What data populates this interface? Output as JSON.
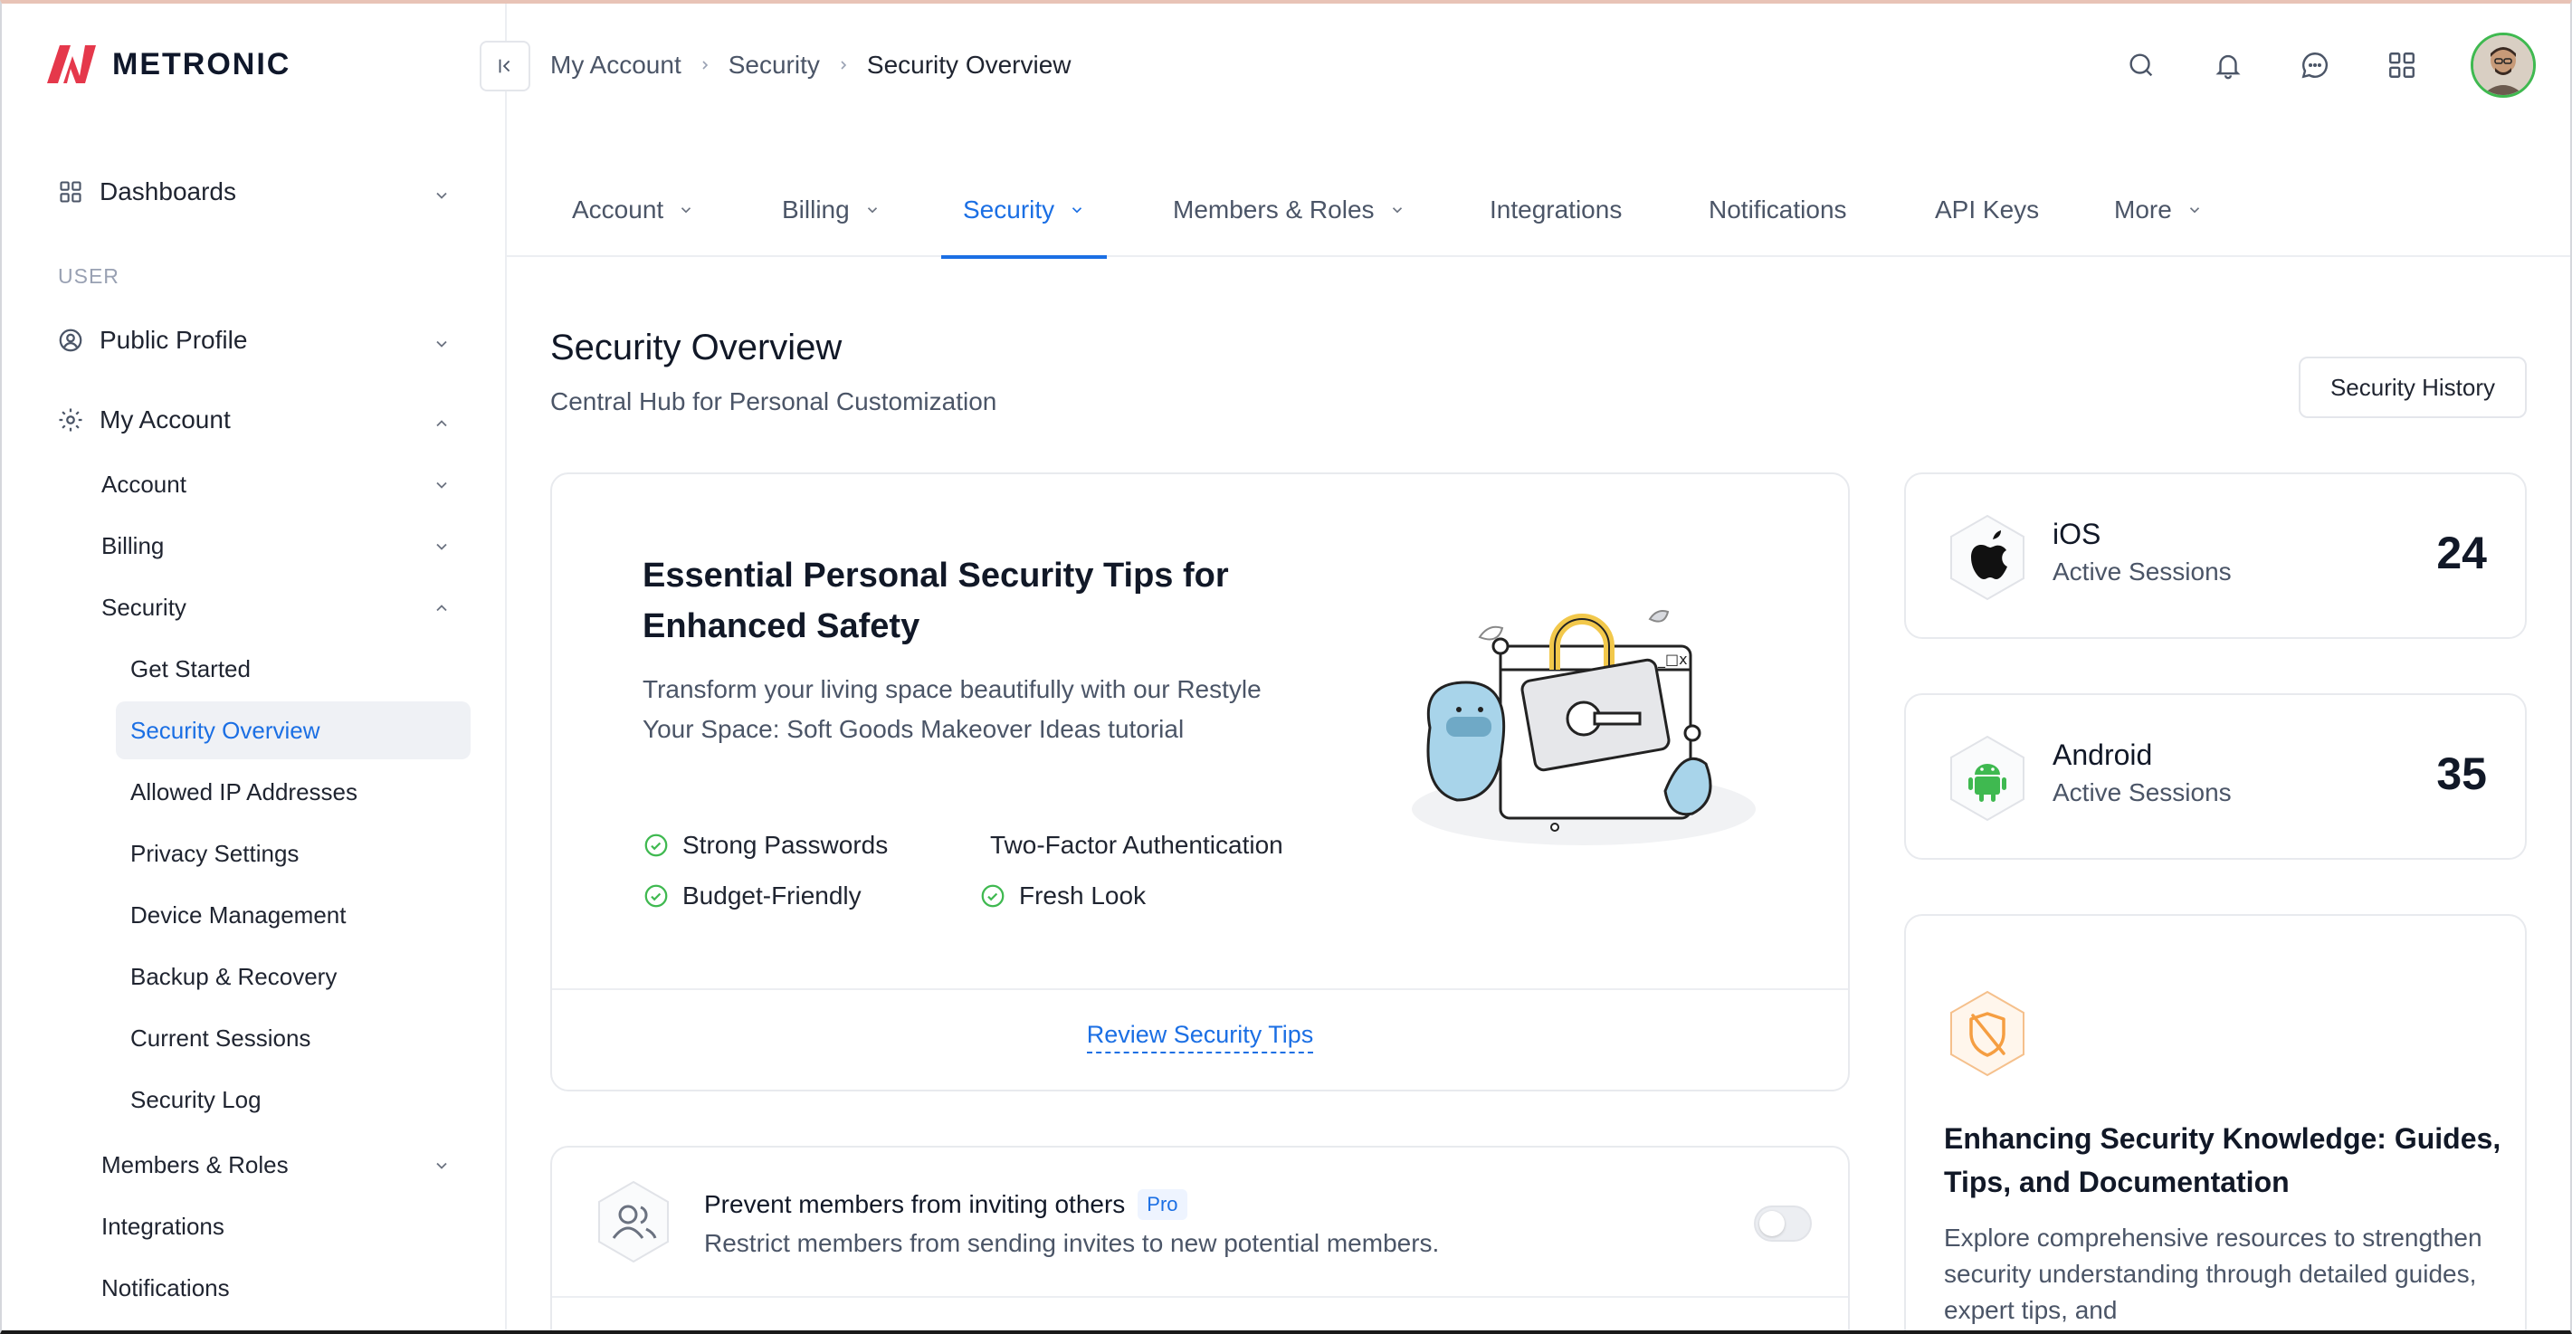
{
  "app": {
    "logo_text": "METRONIC"
  },
  "sidebar": {
    "dashboards": "Dashboards",
    "section_user": "USER",
    "public_profile": "Public Profile",
    "my_account": "My Account",
    "account": "Account",
    "billing": "Billing",
    "security": "Security",
    "security_items": [
      "Get Started",
      "Security Overview",
      "Allowed IP Addresses",
      "Privacy Settings",
      "Device Management",
      "Backup & Recovery",
      "Current Sessions",
      "Security Log"
    ],
    "members_roles": "Members & Roles",
    "integrations": "Integrations",
    "notifications": "Notifications"
  },
  "breadcrumb": {
    "items": [
      "My Account",
      "Security"
    ],
    "current": "Security Overview"
  },
  "tabs": [
    "Account",
    "Billing",
    "Security",
    "Members & Roles",
    "Integrations",
    "Notifications",
    "API Keys",
    "More"
  ],
  "page": {
    "title": "Security Overview",
    "subtitle": "Central Hub for Personal Customization",
    "history_button": "Security History"
  },
  "tips_card": {
    "title": "Essential Personal Security Tips for Enhanced Safety",
    "description": "Transform your living space beautifully with our Restyle Your Space: Soft Goods Makeover Ideas tutorial",
    "tips": [
      "Strong Passwords",
      "Two-Factor Authentication",
      "Budget-Friendly",
      "Fresh Look"
    ],
    "link": "Review Security Tips"
  },
  "prevent_card": {
    "title": "Prevent members from inviting others",
    "badge": "Pro",
    "description": "Restrict members from sending invites to new potential members.",
    "enabled": false
  },
  "sessions": [
    {
      "platform": "iOS",
      "label": "Active Sessions",
      "count": "24",
      "icon": "apple-icon"
    },
    {
      "platform": "Android",
      "label": "Active Sessions",
      "count": "35",
      "icon": "android-icon"
    }
  ],
  "knowledge_card": {
    "title": "Enhancing Security Knowledge: Guides, Tips, and Documentation",
    "description": "Explore comprehensive resources to strengthen security understanding through detailed guides, expert tips, and",
    "icon": "shield-off-icon"
  },
  "colors": {
    "accent": "#1b6fe4",
    "success": "#3fb950",
    "warning": "#f59e42",
    "logo_red": "#e5384b"
  }
}
